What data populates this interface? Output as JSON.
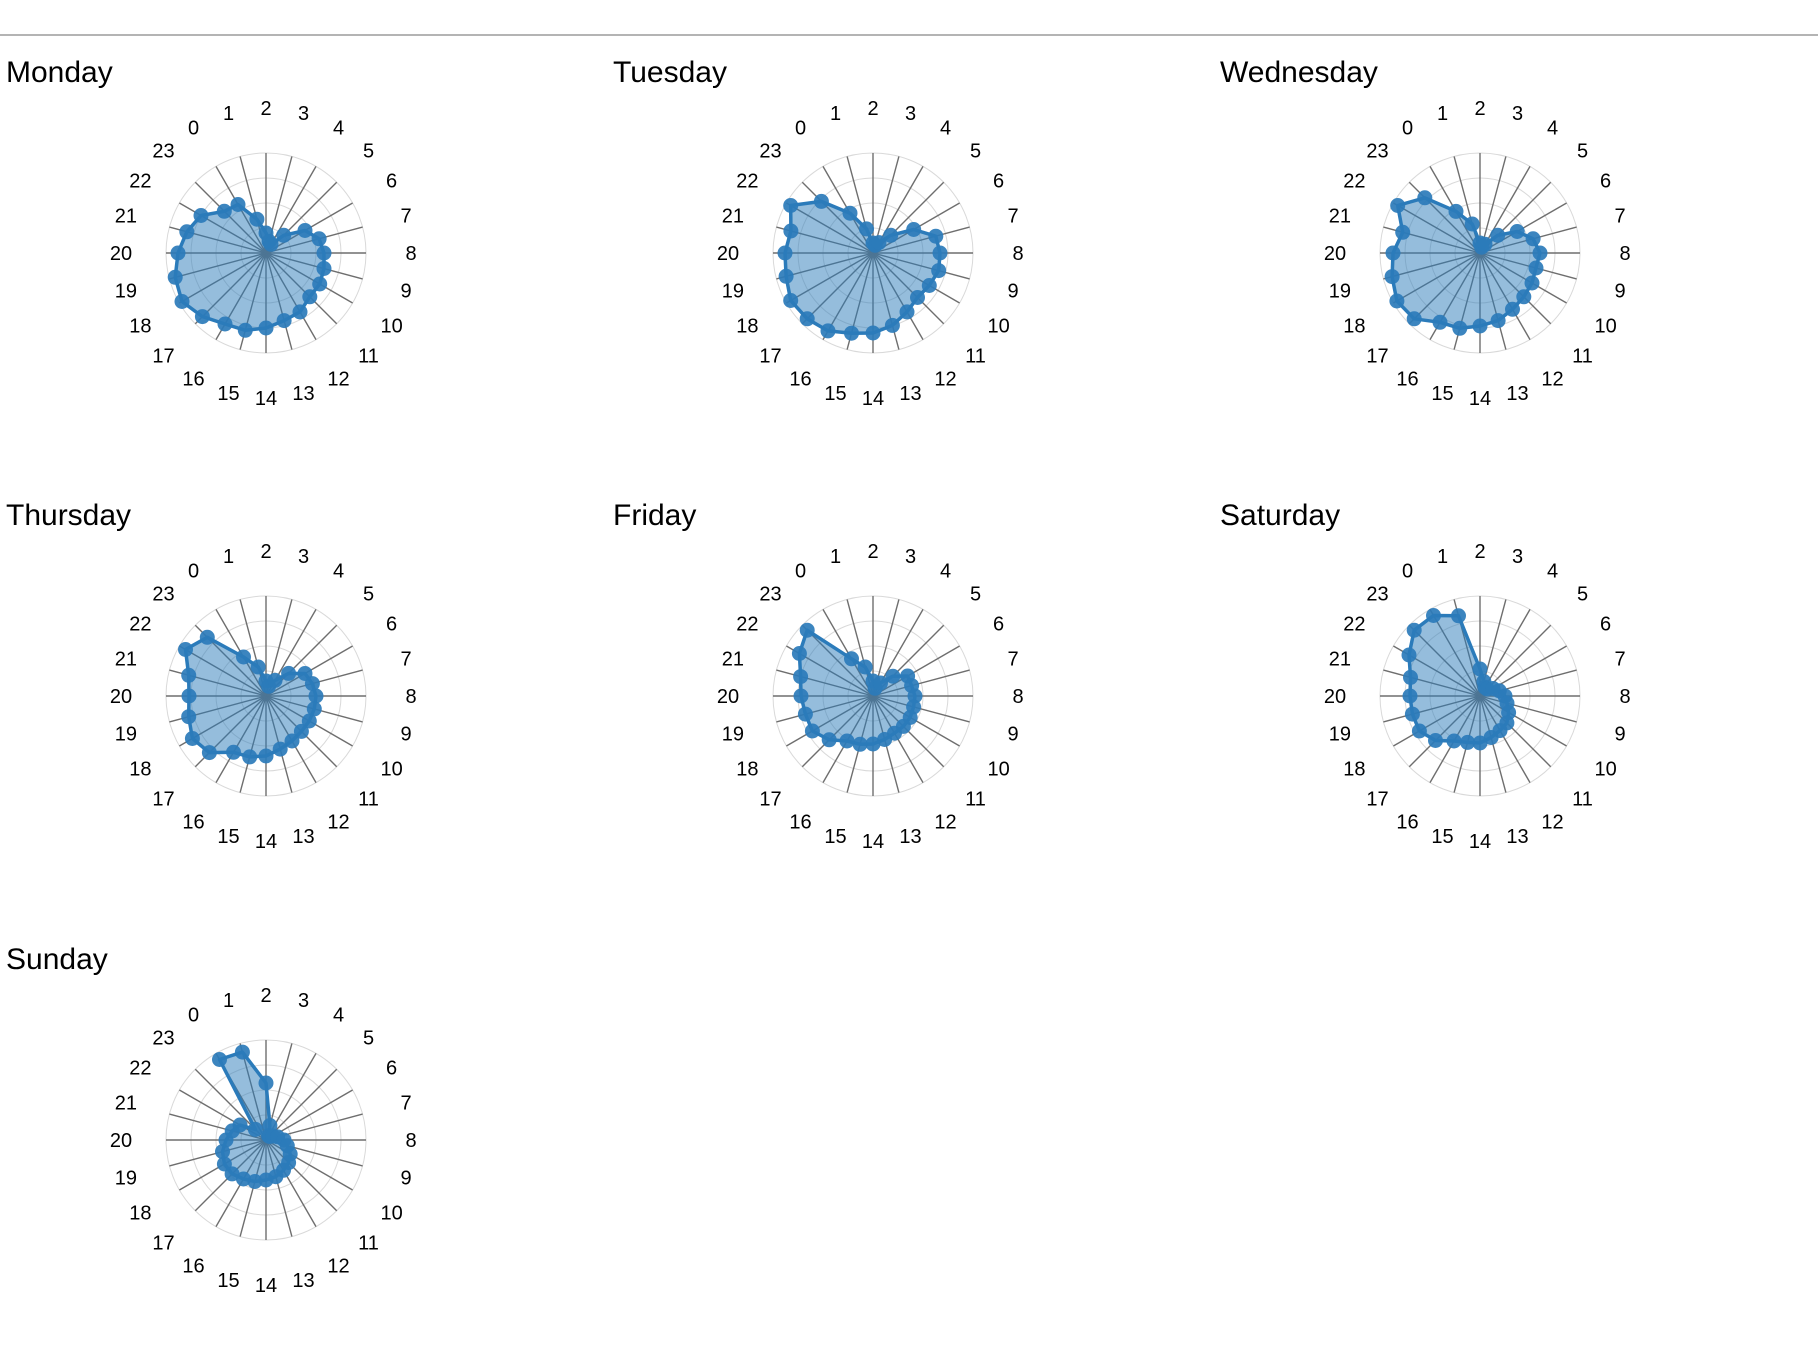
{
  "colors": {
    "series_stroke": "#2b7bba",
    "series_fill": "#2b7bba",
    "spoke": "#6e6e6e",
    "ring": "#d9d9d9"
  },
  "chart_data": [
    {
      "type": "radar",
      "title": "Monday",
      "theta": [
        "0",
        "1",
        "2",
        "3",
        "4",
        "5",
        "6",
        "7",
        "8",
        "9",
        "10",
        "11",
        "12",
        "13",
        "14",
        "15",
        "16",
        "17",
        "18",
        "19",
        "20",
        "21",
        "22",
        "23"
      ],
      "values": [
        0.56,
        0.35,
        0.2,
        0.12,
        0.1,
        0.25,
        0.45,
        0.55,
        0.58,
        0.6,
        0.62,
        0.62,
        0.68,
        0.7,
        0.75,
        0.8,
        0.82,
        0.9,
        0.97,
        0.94,
        0.88,
        0.82,
        0.75,
        0.59
      ],
      "rlim": [
        0,
        1
      ],
      "rings": 4,
      "grid": true
    },
    {
      "type": "radar",
      "title": "Tuesday",
      "theta": [
        "0",
        "1",
        "2",
        "3",
        "4",
        "5",
        "6",
        "7",
        "8",
        "9",
        "10",
        "11",
        "12",
        "13",
        "14",
        "15",
        "16",
        "17",
        "18",
        "19",
        "20",
        "21",
        "22",
        "23"
      ],
      "values": [
        0.46,
        0.25,
        0.1,
        0.08,
        0.12,
        0.25,
        0.47,
        0.65,
        0.67,
        0.68,
        0.65,
        0.63,
        0.68,
        0.75,
        0.8,
        0.83,
        0.9,
        0.93,
        0.95,
        0.9,
        0.88,
        0.85,
        0.95,
        0.73
      ],
      "rlim": [
        0,
        1
      ],
      "rings": 4,
      "grid": true
    },
    {
      "type": "radar",
      "title": "Wednesday",
      "theta": [
        "0",
        "1",
        "2",
        "3",
        "4",
        "5",
        "6",
        "7",
        "8",
        "9",
        "10",
        "11",
        "12",
        "13",
        "14",
        "15",
        "16",
        "17",
        "18",
        "19",
        "20",
        "21",
        "22",
        "23"
      ],
      "values": [
        0.48,
        0.3,
        0.1,
        0.06,
        0.1,
        0.25,
        0.43,
        0.55,
        0.6,
        0.58,
        0.6,
        0.62,
        0.65,
        0.7,
        0.73,
        0.78,
        0.8,
        0.93,
        0.96,
        0.91,
        0.87,
        0.8,
        0.95,
        0.78
      ],
      "rlim": [
        0,
        1
      ],
      "rings": 4,
      "grid": true
    },
    {
      "type": "radar",
      "title": "Thursday",
      "theta": [
        "0",
        "1",
        "2",
        "3",
        "4",
        "5",
        "6",
        "7",
        "8",
        "9",
        "10",
        "11",
        "12",
        "13",
        "14",
        "15",
        "16",
        "17",
        "18",
        "19",
        "20",
        "21",
        "22",
        "23"
      ],
      "values": [
        0.45,
        0.3,
        0.15,
        0.1,
        0.18,
        0.32,
        0.45,
        0.48,
        0.5,
        0.5,
        0.5,
        0.5,
        0.52,
        0.55,
        0.6,
        0.63,
        0.65,
        0.8,
        0.85,
        0.8,
        0.77,
        0.8,
        0.93,
        0.83
      ],
      "rlim": [
        0,
        1
      ],
      "rings": 4,
      "grid": true
    },
    {
      "type": "radar",
      "title": "Friday",
      "theta": [
        "0",
        "1",
        "2",
        "3",
        "4",
        "5",
        "6",
        "7",
        "8",
        "9",
        "10",
        "11",
        "12",
        "13",
        "14",
        "15",
        "16",
        "17",
        "18",
        "19",
        "20",
        "21",
        "22",
        "23"
      ],
      "values": [
        0.43,
        0.3,
        0.15,
        0.08,
        0.15,
        0.28,
        0.4,
        0.4,
        0.42,
        0.42,
        0.43,
        0.43,
        0.43,
        0.45,
        0.48,
        0.5,
        0.52,
        0.62,
        0.7,
        0.7,
        0.72,
        0.75,
        0.85,
        0.93
      ],
      "rlim": [
        0,
        1
      ],
      "rings": 4,
      "grid": true
    },
    {
      "type": "radar",
      "title": "Saturday",
      "theta": [
        "0",
        "1",
        "2",
        "3",
        "4",
        "5",
        "6",
        "7",
        "8",
        "9",
        "10",
        "11",
        "12",
        "13",
        "14",
        "15",
        "16",
        "17",
        "18",
        "19",
        "20",
        "21",
        "22",
        "23"
      ],
      "values": [
        0.93,
        0.83,
        0.27,
        0.15,
        0.1,
        0.1,
        0.15,
        0.2,
        0.25,
        0.28,
        0.33,
        0.38,
        0.4,
        0.43,
        0.47,
        0.48,
        0.52,
        0.63,
        0.7,
        0.7,
        0.7,
        0.72,
        0.82,
        0.93
      ],
      "rlim": [
        0,
        1
      ],
      "rings": 4,
      "grid": true
    },
    {
      "type": "radar",
      "title": "Sunday",
      "theta": [
        "0",
        "1",
        "2",
        "3",
        "4",
        "5",
        "6",
        "7",
        "8",
        "9",
        "10",
        "11",
        "12",
        "13",
        "14",
        "15",
        "16",
        "17",
        "18",
        "19",
        "20",
        "21",
        "22",
        "23"
      ],
      "values": [
        0.93,
        0.91,
        0.57,
        0.15,
        0.05,
        0.05,
        0.08,
        0.12,
        0.18,
        0.22,
        0.28,
        0.32,
        0.35,
        0.38,
        0.4,
        0.43,
        0.45,
        0.48,
        0.48,
        0.45,
        0.4,
        0.35,
        0.3,
        0.15
      ],
      "rlim": [
        0,
        1
      ],
      "rings": 4,
      "grid": true
    }
  ]
}
